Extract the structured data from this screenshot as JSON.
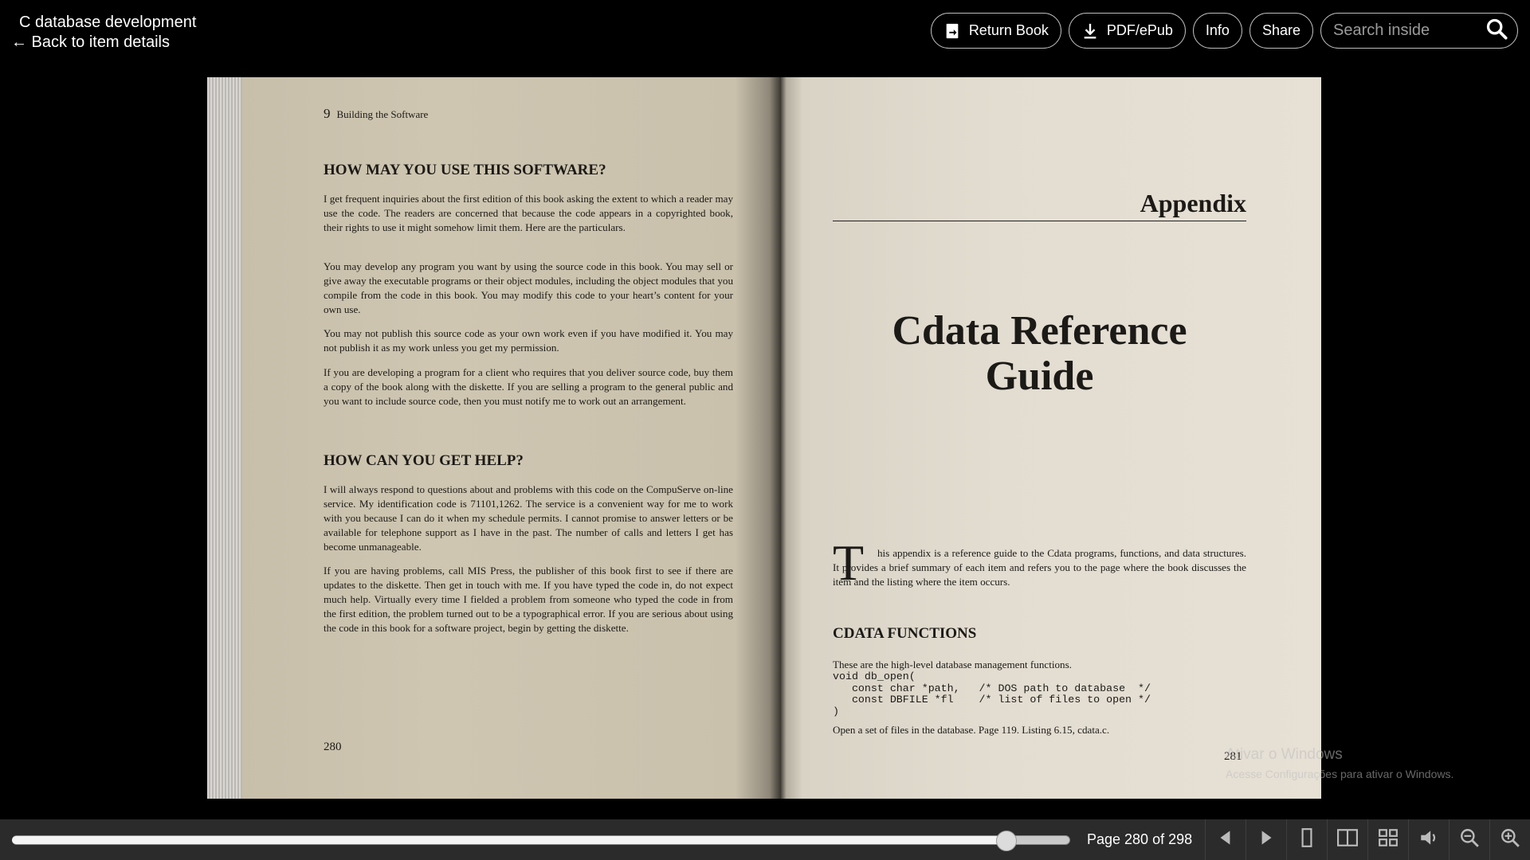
{
  "header": {
    "book_title": "C database development",
    "back_link": "← Back to item details"
  },
  "actions": {
    "return_book": "Return Book",
    "pdf_epub": "PDF/ePub",
    "info": "Info",
    "share": "Share",
    "search_placeholder": "Search inside"
  },
  "left_page": {
    "chapter_number": "9",
    "running_head": "Building the Software",
    "heading1": "HOW MAY YOU USE THIS SOFTWARE?",
    "para1": "I get frequent inquiries about the first edition of this book asking the extent to which a reader may use the code. The readers are concerned that because the code appears in a copyrighted book, their rights to use it might somehow limit them. Here are the particulars.",
    "para2": "You may develop any program you want by using the source code in this book. You may sell or give away the executable programs or their object modules, including the object modules that you compile from the code in this book. You may modify this code to your heart’s content for your own use.",
    "para3": "You may not publish this source code as your own work even if you have modified it. You may not publish it as my work unless you get my permission.",
    "para4": "If you are developing a program for a client who requires that you deliver source code, buy them a copy of the book along with the diskette. If you are selling a program to the general public and you want to include source code, then you must notify me to work out an arrangement.",
    "heading2": "HOW CAN YOU GET HELP?",
    "para5": "I will always respond to questions about and problems with this code on the CompuServe on-line service. My identification code is 71101,1262. The service is a convenient way for me to work with you because I can do it when my schedule permits. I cannot promise to answer letters or be available for telephone support as I have in the past. The number of calls and letters I get has become unmanageable.",
    "para6": "If you are having problems, call MIS Press, the publisher of this book first to see if there are updates to the diskette. Then get in touch with me. If you have typed the code in, do not expect much help. Virtually every time I fielded a problem from someone who typed the code in from the first edition, the problem turned out to be a typographical error. If you are serious about using the code in this book for a software project, begin by getting the diskette.",
    "page_number": "280"
  },
  "right_page": {
    "appendix_label": "Appendix",
    "title_line1": "Cdata Reference",
    "title_line2": "Guide",
    "drop_cap": "T",
    "intro": "his appendix is a reference guide to the Cdata programs, functions, and data structures. It provides a brief summary of each item and refers you to the page where the book discusses the item and the listing where the item occurs.",
    "section_heading": "CDATA FUNCTIONS",
    "section_intro": "These are the high-level database management functions.",
    "code_line1": "void db_open(",
    "code_line2": "   const char *path,   /* DOS path to database  */",
    "code_line3": "   const DBFILE *fl    /* list of files to open */",
    "code_line4": ")",
    "code_desc": "Open a set of files in the database. Page 119. Listing 6.15, cdata.c.",
    "page_number": "281"
  },
  "watermark": {
    "line1": "Ativar o Windows",
    "line2": "Acesse Configurações para ativar o Windows."
  },
  "nav": {
    "current_page": 280,
    "total_pages": 298,
    "page_indicator": "Page 280 of 298",
    "icons": [
      "prev-page-icon",
      "next-page-icon",
      "one-page-view-icon",
      "two-page-view-icon",
      "thumbnail-view-icon",
      "read-aloud-icon",
      "zoom-out-icon",
      "zoom-in-icon"
    ]
  }
}
